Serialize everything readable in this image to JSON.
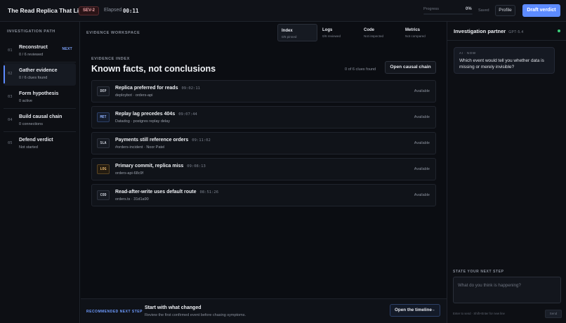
{
  "header": {
    "title": "The Read Replica That Lied",
    "severity": "SEV-2",
    "elapsed_label": "Elapsed",
    "elapsed_value": "00:11",
    "progress_label": "Progress",
    "progress_value": "0%",
    "progress_fraction": 0,
    "saved_label": "Saved",
    "profile_label": "Profile",
    "verdict_label": "Draft verdict"
  },
  "sidebar": {
    "heading": "INVESTIGATION PATH",
    "steps": [
      {
        "num": "01",
        "title": "Reconstruct",
        "sub": "0 / 6 reviewed",
        "badge": "NEXT"
      },
      {
        "num": "02",
        "title": "Gather evidence",
        "sub": "0 / 6 clues found",
        "badge": ""
      },
      {
        "num": "03",
        "title": "Form hypothesis",
        "sub": "0 active",
        "badge": ""
      },
      {
        "num": "04",
        "title": "Build causal chain",
        "sub": "0 connections",
        "badge": ""
      },
      {
        "num": "05",
        "title": "Defend verdict",
        "sub": "Not started",
        "badge": ""
      }
    ]
  },
  "workspace": {
    "label": "EVIDENCE WORKSPACE",
    "tabs": [
      {
        "name": "Index",
        "sub": "0/6 pinned"
      },
      {
        "name": "Logs",
        "sub": "0/6 reviewed"
      },
      {
        "name": "Code",
        "sub": "Not inspected"
      },
      {
        "name": "Metrics",
        "sub": "Not compared"
      }
    ]
  },
  "evidence": {
    "subtitle": "EVIDENCE INDEX",
    "title": "Known facts, not conclusions",
    "clue_count": "0 of 6 clues found",
    "causal_button": "Open causal chain",
    "cards": [
      {
        "tag": "DEP",
        "title": "Replica preferred for reads",
        "time": "09:02:11",
        "meta": "deploybot · orders-api",
        "status": "Available"
      },
      {
        "tag": "MET",
        "title": "Replay lag precedes 404s",
        "time": "09:07:44",
        "meta": "Datadog · postgres replay delay",
        "status": "Available"
      },
      {
        "tag": "SLA",
        "title": "Payments still reference orders",
        "time": "09:11:02",
        "meta": "#orders-incident · Noor Patel",
        "status": "Available"
      },
      {
        "tag": "LOG",
        "title": "Primary commit, replica miss",
        "time": "09:08:13",
        "meta": "orders-api-68c9f",
        "status": "Available"
      },
      {
        "tag": "COD",
        "title": "Read-after-write uses default route",
        "time": "08:51:26",
        "meta": "orders.ts · 31d1a90",
        "status": "Available"
      }
    ]
  },
  "recommend": {
    "label": "RECOMMENDED NEXT STEP",
    "title": "Start with what changed",
    "sub": "Review the first confirmed event before chasing symptoms.",
    "button": "Open the timeline"
  },
  "partner": {
    "title": "Investigation partner",
    "model": "GPT-5.4",
    "bubble_meta": "AI · NOW",
    "bubble_text": "Which event would tell you whether data is missing or merely invisible?",
    "next_step_label": "STATE YOUR NEXT STEP",
    "input_placeholder": "What do you think is happening?",
    "hint": "Enter to send · Shift+Enter for new line",
    "send_label": "Send"
  }
}
